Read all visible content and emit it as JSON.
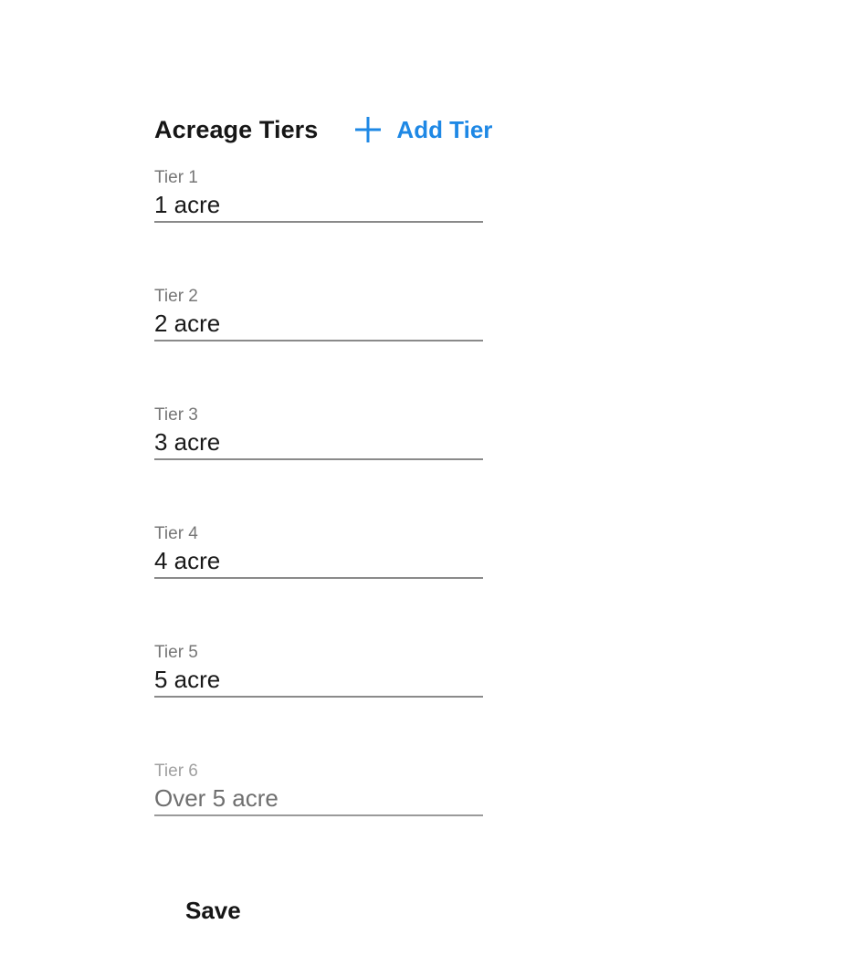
{
  "section": {
    "title": "Acreage Tiers",
    "add_button_label": "Add Tier",
    "add_icon": "plus-icon",
    "accent_color": "#1e88e5"
  },
  "tiers": [
    {
      "label": "Tier 1",
      "value": "1 acre",
      "disabled": false
    },
    {
      "label": "Tier 2",
      "value": "2 acre",
      "disabled": false
    },
    {
      "label": "Tier 3",
      "value": "3 acre",
      "disabled": false
    },
    {
      "label": "Tier 4",
      "value": "4 acre",
      "disabled": false
    },
    {
      "label": "Tier 5",
      "value": "5 acre",
      "disabled": false
    },
    {
      "label": "Tier 6",
      "value": "Over 5 acre",
      "disabled": true
    }
  ],
  "actions": {
    "save_label": "Save"
  }
}
